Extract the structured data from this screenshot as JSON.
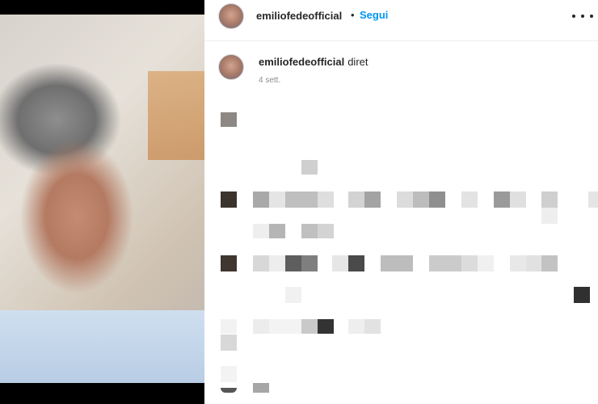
{
  "post": {
    "header": {
      "username": "emiliofedeofficial",
      "separator": "•",
      "follow_label": "Segui",
      "more_icon": "more-horizontal-icon"
    },
    "caption": {
      "username": "emiliofedeofficial",
      "text": "diret",
      "timestamp": "4 sett."
    }
  }
}
